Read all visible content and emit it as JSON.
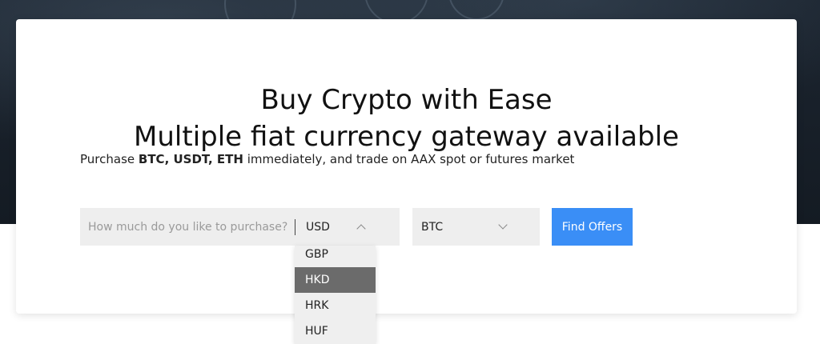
{
  "hero": {
    "title_line1": "Buy Crypto with Ease",
    "title_line2": "Multiple fiat currency gateway available"
  },
  "subline": {
    "prefix": "Purchase ",
    "highlight": "BTC, USDT, ETH",
    "suffix": " immediately, and trade on AAX spot or futures market"
  },
  "form": {
    "amount_placeholder": "How much do you like to purchase?",
    "fiat_selected": "USD",
    "crypto_selected": "BTC",
    "find_label": "Find Offers"
  },
  "fiat_dropdown": {
    "options": [
      "GBP",
      "HKD",
      "HRK",
      "HUF"
    ],
    "highlighted": "HKD"
  },
  "colors": {
    "accent": "#3a8ef6",
    "hero_bg": "#141b23",
    "highlight_row": "#6b6b6b"
  }
}
